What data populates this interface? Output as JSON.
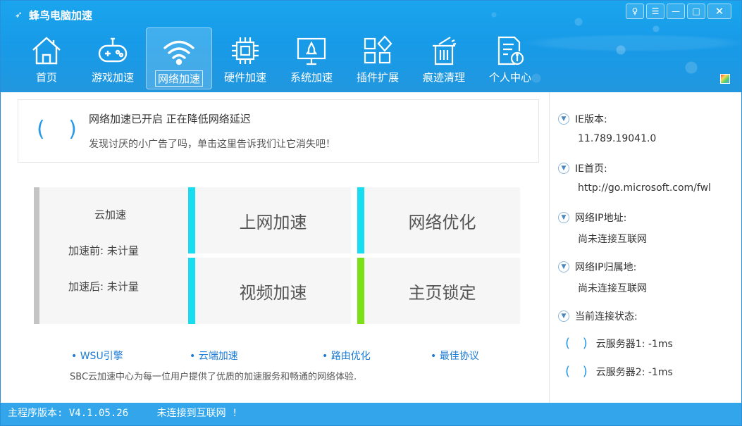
{
  "app": {
    "title": "蜂鸟电脑加速"
  },
  "window_controls": {
    "feedback": "♀",
    "menu": "☰",
    "minimize": "—",
    "maximize": "□",
    "close": "✕"
  },
  "nav": [
    {
      "label": "首页",
      "icon": "home-icon"
    },
    {
      "label": "游戏加速",
      "icon": "gamepad-icon"
    },
    {
      "label": "网络加速",
      "icon": "wifi-icon",
      "active": true
    },
    {
      "label": "硬件加速",
      "icon": "chip-icon"
    },
    {
      "label": "系统加速",
      "icon": "monitor-rocket-icon"
    },
    {
      "label": "插件扩展",
      "icon": "plugin-icon"
    },
    {
      "label": "痕迹清理",
      "icon": "trash-icon"
    },
    {
      "label": "个人中心",
      "icon": "user-doc-icon"
    }
  ],
  "status": {
    "spinner": "( )",
    "headline": "网络加速已开启 正在降低网络延迟",
    "report_link": "发现讨厌的小广告了吗，单击这里告诉我们让它消失吧！"
  },
  "accel": {
    "cloud_label": "云加速",
    "before": "加速前:   未计量",
    "after": "加速后:   未计量",
    "tiles": [
      "上网加速",
      "网络优化",
      "视频加速",
      "主页锁定"
    ]
  },
  "features": [
    "• WSU引擎",
    "• 云端加速",
    "• 路由优化",
    "• 最佳协议"
  ],
  "description": "SBC云加速中心为每一位用户提供了优质的加速服务和畅通的网络体验.",
  "info": {
    "ie_version_label": "IE版本:",
    "ie_version": "11.789.19041.0",
    "ie_home_label": "IE首页:",
    "ie_home": "http://go.microsoft.com/fwl",
    "ip_label": "网络IP地址:",
    "ip_value": "尚未连接互联网",
    "ip_loc_label": "网络IP归属地:",
    "ip_loc_value": "尚未连接互联网",
    "conn_label": "当前连接状态:",
    "server1": "云服务器1:   -1ms",
    "server2": "云服务器2:   -1ms"
  },
  "statusbar": {
    "version": "主程序版本: V4.1.05.26",
    "network": "未连接到互联网 !"
  },
  "colors": {
    "header": "#1ba5ee",
    "tile_accent": "#18dcf0",
    "tile_accent_green": "#7ce018",
    "link": "#1a7ad6",
    "statusbar": "#33a6eb"
  }
}
